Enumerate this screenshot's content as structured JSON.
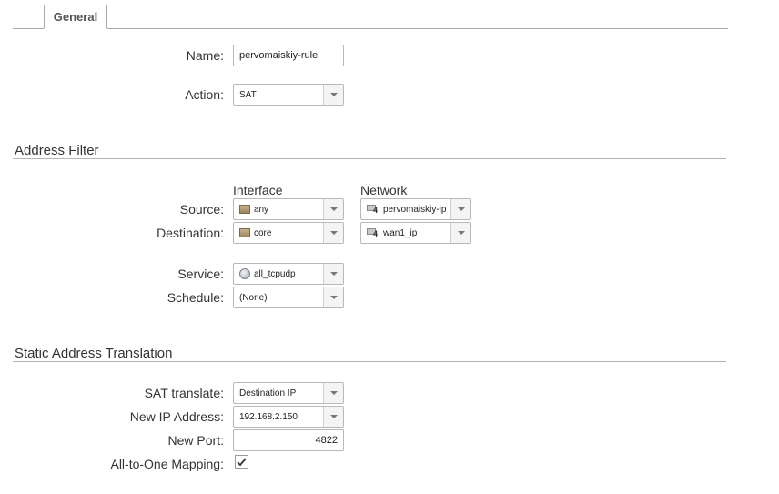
{
  "tabs": {
    "general": "General"
  },
  "general": {
    "name_label": "Name:",
    "name_value": "pervomaiskiy-rule",
    "action_label": "Action:",
    "action_value": "SAT"
  },
  "address_filter": {
    "title": "Address Filter",
    "col_interface": "Interface",
    "col_network": "Network",
    "source_label": "Source:",
    "source_interface": "any",
    "source_network": "pervomaiskiy-ip",
    "destination_label": "Destination:",
    "destination_interface": "core",
    "destination_network": "wan1_ip",
    "service_label": "Service:",
    "service_value": "all_tcpudp",
    "schedule_label": "Schedule:",
    "schedule_value": "(None)"
  },
  "sat": {
    "title": "Static Address Translation",
    "translate_label": "SAT translate:",
    "translate_value": "Destination IP",
    "new_ip_label": "New IP Address:",
    "new_ip_value": "192.168.2.150",
    "new_port_label": "New Port:",
    "new_port_value": "4822",
    "all_to_one_label": "All-to-One Mapping:",
    "all_to_one_checked": true
  },
  "icons": {
    "interface": "interface-icon",
    "network": "network-address-icon",
    "service": "service-icon",
    "dropdown": "chevron-down-icon",
    "check": "checkmark-icon"
  }
}
